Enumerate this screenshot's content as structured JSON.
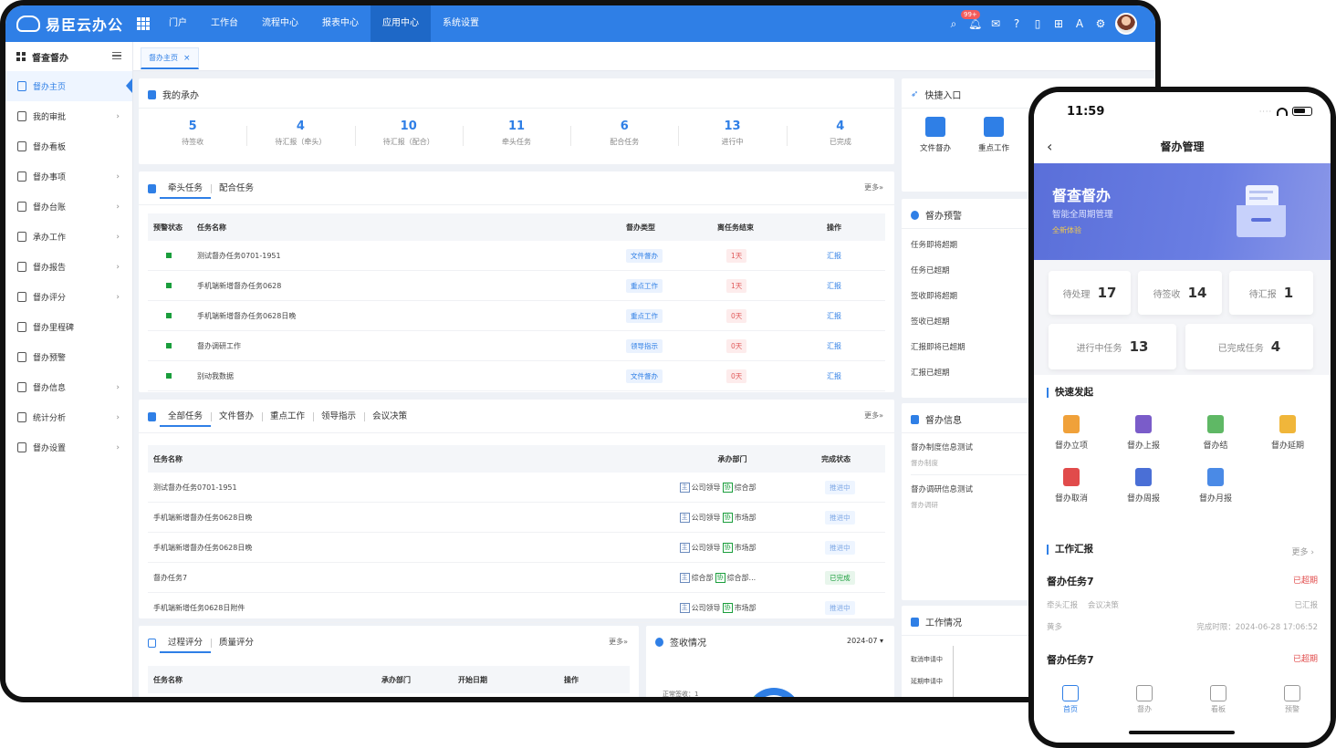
{
  "app": {
    "brand": "易臣云办公",
    "top_nav": [
      "门户",
      "工作台",
      "流程中心",
      "报表中心",
      "应用中心",
      "系统设置"
    ],
    "active_top": "应用中心",
    "notif_badge": "99+"
  },
  "sidebar": {
    "title": "督查督办",
    "items": [
      {
        "label": "督办主页",
        "arrow": ""
      },
      {
        "label": "我的审批",
        "arrow": "›"
      },
      {
        "label": "督办看板",
        "arrow": ""
      },
      {
        "label": "督办事项",
        "arrow": "›"
      },
      {
        "label": "督办台账",
        "arrow": "›"
      },
      {
        "label": "承办工作",
        "arrow": "›"
      },
      {
        "label": "督办报告",
        "arrow": "›"
      },
      {
        "label": "督办评分",
        "arrow": "›"
      },
      {
        "label": "督办里程碑",
        "arrow": ""
      },
      {
        "label": "督办预警",
        "arrow": ""
      },
      {
        "label": "督办信息",
        "arrow": "›"
      },
      {
        "label": "统计分析",
        "arrow": "›"
      },
      {
        "label": "督办设置",
        "arrow": "›"
      }
    ]
  },
  "open_tab": {
    "label": "督办主页",
    "close": "×"
  },
  "my_tasks": {
    "title": "我的承办",
    "stats": [
      {
        "num": "5",
        "label": "待签收"
      },
      {
        "num": "4",
        "label": "待汇报（牵头）"
      },
      {
        "num": "10",
        "label": "待汇报（配合）"
      },
      {
        "num": "11",
        "label": "牵头任务"
      },
      {
        "num": "6",
        "label": "配合任务"
      },
      {
        "num": "13",
        "label": "进行中"
      },
      {
        "num": "4",
        "label": "已完成"
      }
    ]
  },
  "lead_tasks": {
    "tabs": [
      "牵头任务",
      "配合任务"
    ],
    "more": "更多»",
    "headers": [
      "预警状态",
      "任务名称",
      "督办类型",
      "离任务结束",
      "操作"
    ],
    "rows": [
      {
        "name": "测试督办任务0701-1951",
        "type": "文件督办",
        "days": "1天",
        "op": "汇报"
      },
      {
        "name": "手机端新增督办任务0628",
        "type": "重点工作",
        "days": "1天",
        "op": "汇报"
      },
      {
        "name": "手机端新增督办任务0628日晚",
        "type": "重点工作",
        "days": "0天",
        "op": "汇报"
      },
      {
        "name": "督办调研工作",
        "type": "领导指示",
        "days": "0天",
        "op": "汇报"
      },
      {
        "name": "别动我数据",
        "type": "文件督办",
        "days": "0天",
        "op": "汇报"
      }
    ]
  },
  "all_tasks": {
    "tabs": [
      "全部任务",
      "文件督办",
      "重点工作",
      "领导指示",
      "会议决策"
    ],
    "more": "更多»",
    "headers": [
      "任务名称",
      "承办部门",
      "完成状态"
    ],
    "zhu": "主",
    "xie": "协",
    "rows": [
      {
        "name": "测试督办任务0701-1951",
        "lead": "公司领导",
        "co": "综合部",
        "status": "推进中",
        "done": false
      },
      {
        "name": "手机端新增督办任务0628日晚",
        "lead": "公司领导",
        "co": "市场部",
        "status": "推进中",
        "done": false
      },
      {
        "name": "手机端新增督办任务0628日晚",
        "lead": "公司领导",
        "co": "市场部",
        "status": "推进中",
        "done": false
      },
      {
        "name": "督办任务7",
        "lead": "综合部",
        "co": "综合部...",
        "status": "已完成",
        "done": true
      },
      {
        "name": "手机端新增任务0628日附件",
        "lead": "公司领导",
        "co": "市场部",
        "status": "推进中",
        "done": false
      }
    ]
  },
  "scoring": {
    "tabs": [
      "过程评分",
      "质量评分"
    ],
    "more": "更多»",
    "headers": [
      "任务名称",
      "承办部门",
      "开始日期",
      "操作"
    ]
  },
  "sign": {
    "title": "签收情况",
    "month": "2024-07 ▾",
    "label": "正常签收：1"
  },
  "quick_entry": {
    "title": "快捷入口",
    "items": [
      "文件督办",
      "重点工作"
    ]
  },
  "warning": {
    "title": "督办预警",
    "items": [
      "任务即将超期",
      "任务已超期",
      "签收即将超期",
      "签收已超期",
      "汇报即将已超期",
      "汇报已超期"
    ]
  },
  "info": {
    "title": "督办信息",
    "items": [
      {
        "title": "督办制度信息测试",
        "sub": "督办制度"
      },
      {
        "title": "督办调研信息测试",
        "sub": "督办调研"
      }
    ]
  },
  "work": {
    "title": "工作情况",
    "rows": [
      "取消申请中",
      "延期申请中"
    ]
  },
  "phone": {
    "time": "11:59",
    "title": "督办管理",
    "banner": {
      "title": "督查督办",
      "subtitle": "智能全周期管理",
      "tag": "全新体验"
    },
    "counters": [
      {
        "label": "待处理",
        "num": "17"
      },
      {
        "label": "待签收",
        "num": "14"
      },
      {
        "label": "待汇报",
        "num": "1"
      },
      {
        "label": "进行中任务",
        "num": "13"
      },
      {
        "label": "已完成任务",
        "num": "4"
      }
    ],
    "quick_title": "快速发起",
    "quick": [
      "督办立项",
      "督办上报",
      "督办结",
      "督办延期",
      "督办取消",
      "督办周报",
      "督办月报"
    ],
    "report_title": "工作汇报",
    "report_more": "更多 ›",
    "reports": [
      {
        "title": "督办任务7",
        "status": "已超期",
        "tag1": "牵头汇报",
        "tag2": "会议决策",
        "state": "已汇报",
        "person": "黄多",
        "deadline": "完成时限：2024-06-28 17:06:52"
      },
      {
        "title": "督办任务7",
        "status": "已超期"
      }
    ],
    "tabs": [
      "首页",
      "督办",
      "看板",
      "预警"
    ]
  }
}
